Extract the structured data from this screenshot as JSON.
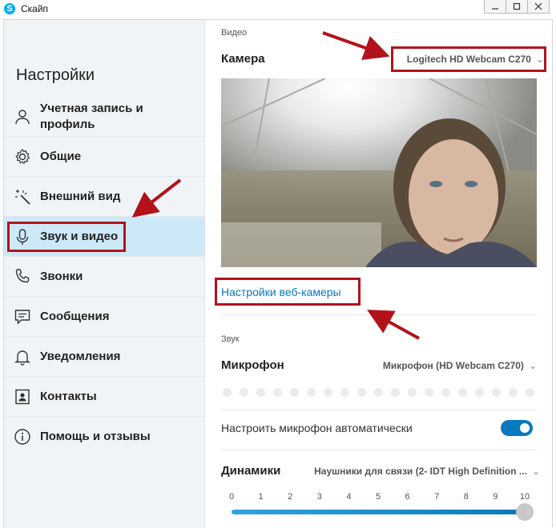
{
  "window": {
    "title": "Скайп"
  },
  "sidebar": {
    "heading": "Настройки",
    "items": [
      {
        "label": "Учетная запись и профиль",
        "icon": "person-icon"
      },
      {
        "label": "Общие",
        "icon": "gear-icon"
      },
      {
        "label": "Внешний вид",
        "icon": "magic-wand-icon"
      },
      {
        "label": "Звук и видео",
        "icon": "microphone-icon",
        "active": true
      },
      {
        "label": "Звонки",
        "icon": "phone-icon"
      },
      {
        "label": "Сообщения",
        "icon": "chat-icon"
      },
      {
        "label": "Уведомления",
        "icon": "bell-icon"
      },
      {
        "label": "Контакты",
        "icon": "contact-card-icon"
      },
      {
        "label": "Помощь и отзывы",
        "icon": "info-icon"
      }
    ]
  },
  "video": {
    "section_label": "Видео",
    "camera_label": "Камера",
    "camera_value": "Logitech HD Webcam C270",
    "webcam_settings_link": "Настройки веб-камеры"
  },
  "audio": {
    "section_label": "Звук",
    "mic_label": "Микрофон",
    "mic_value": "Микрофон (HD Webcam C270)",
    "mic_level": 0,
    "auto_mic_label": "Настроить микрофон автоматически",
    "auto_mic_enabled": true,
    "speakers_label": "Динамики",
    "speakers_value": "Наушники для связи (2- IDT High Definition ...",
    "volume_ticks": [
      "0",
      "1",
      "2",
      "3",
      "4",
      "5",
      "6",
      "7",
      "8",
      "9",
      "10"
    ],
    "volume_value": 10
  },
  "colors": {
    "accent": "#0a78bf",
    "annotation": "#b3121a",
    "active_bg": "#cde9f7"
  }
}
